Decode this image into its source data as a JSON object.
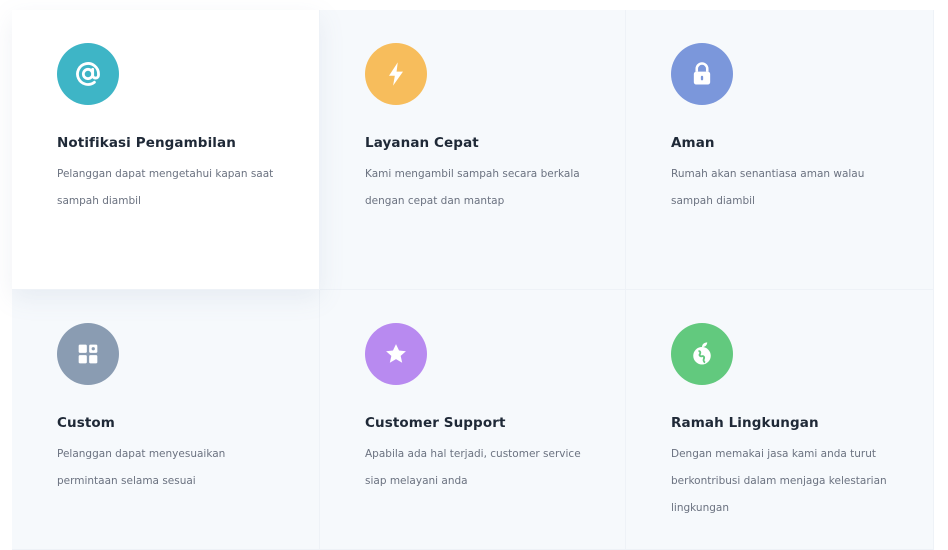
{
  "features": [
    {
      "title": "Notifikasi Pengambilan",
      "description": "Pelanggan dapat mengetahui kapan saat sampah diambil",
      "icon": "at-sign-icon",
      "color": "#3eb5c6"
    },
    {
      "title": "Layanan Cepat",
      "description": "Kami mengambil sampah secara berkala dengan cepat dan mantap",
      "icon": "lightning-icon",
      "color": "#f7bd5c"
    },
    {
      "title": "Aman",
      "description": "Rumah akan senantiasa aman walau sampah diambil",
      "icon": "lock-icon",
      "color": "#7b97db"
    },
    {
      "title": "Custom",
      "description": "Pelanggan dapat menyesuaikan permintaan selama sesuai",
      "icon": "puzzle-icon",
      "color": "#8a9cb2"
    },
    {
      "title": "Customer Support",
      "description": "Apabila ada hal terjadi, customer service siap melayani anda",
      "icon": "star-icon",
      "color": "#b88af0"
    },
    {
      "title": "Ramah Lingkungan",
      "description": "Dengan memakai jasa kami anda turut berkontribusi dalam menjaga kelestarian lingkungan",
      "icon": "eco-globe-icon",
      "color": "#62c97e"
    }
  ]
}
